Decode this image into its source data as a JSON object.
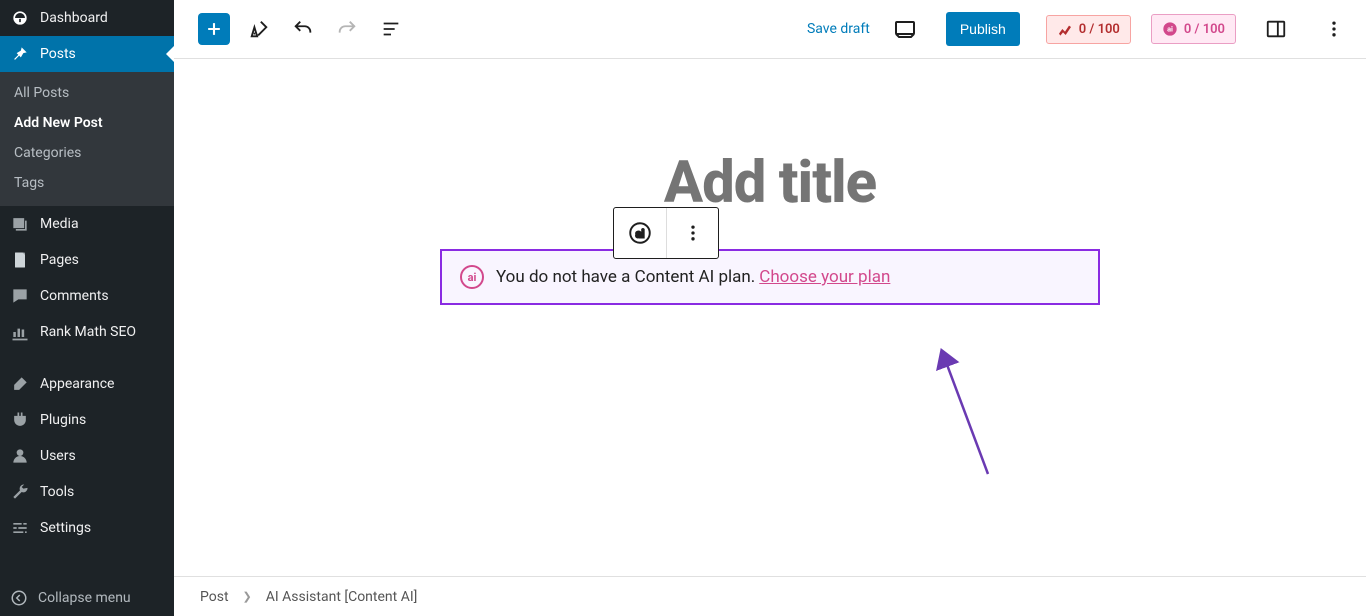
{
  "sidebar": {
    "dashboard": "Dashboard",
    "posts": "Posts",
    "posts_sub": [
      "All Posts",
      "Add New Post",
      "Categories",
      "Tags"
    ],
    "media": "Media",
    "pages": "Pages",
    "comments": "Comments",
    "rankmath": "Rank Math SEO",
    "appearance": "Appearance",
    "plugins": "Plugins",
    "users": "Users",
    "tools": "Tools",
    "settings": "Settings",
    "collapse": "Collapse menu"
  },
  "toolbar": {
    "save_draft": "Save draft",
    "publish": "Publish",
    "score1": "0 / 100",
    "score2": "0 / 100"
  },
  "editor": {
    "title_placeholder": "Add title",
    "ai_message": "You do not have a Content AI plan.",
    "ai_link": "Choose your plan"
  },
  "footer": {
    "crumb1": "Post",
    "crumb2": "AI Assistant [Content AI]"
  }
}
